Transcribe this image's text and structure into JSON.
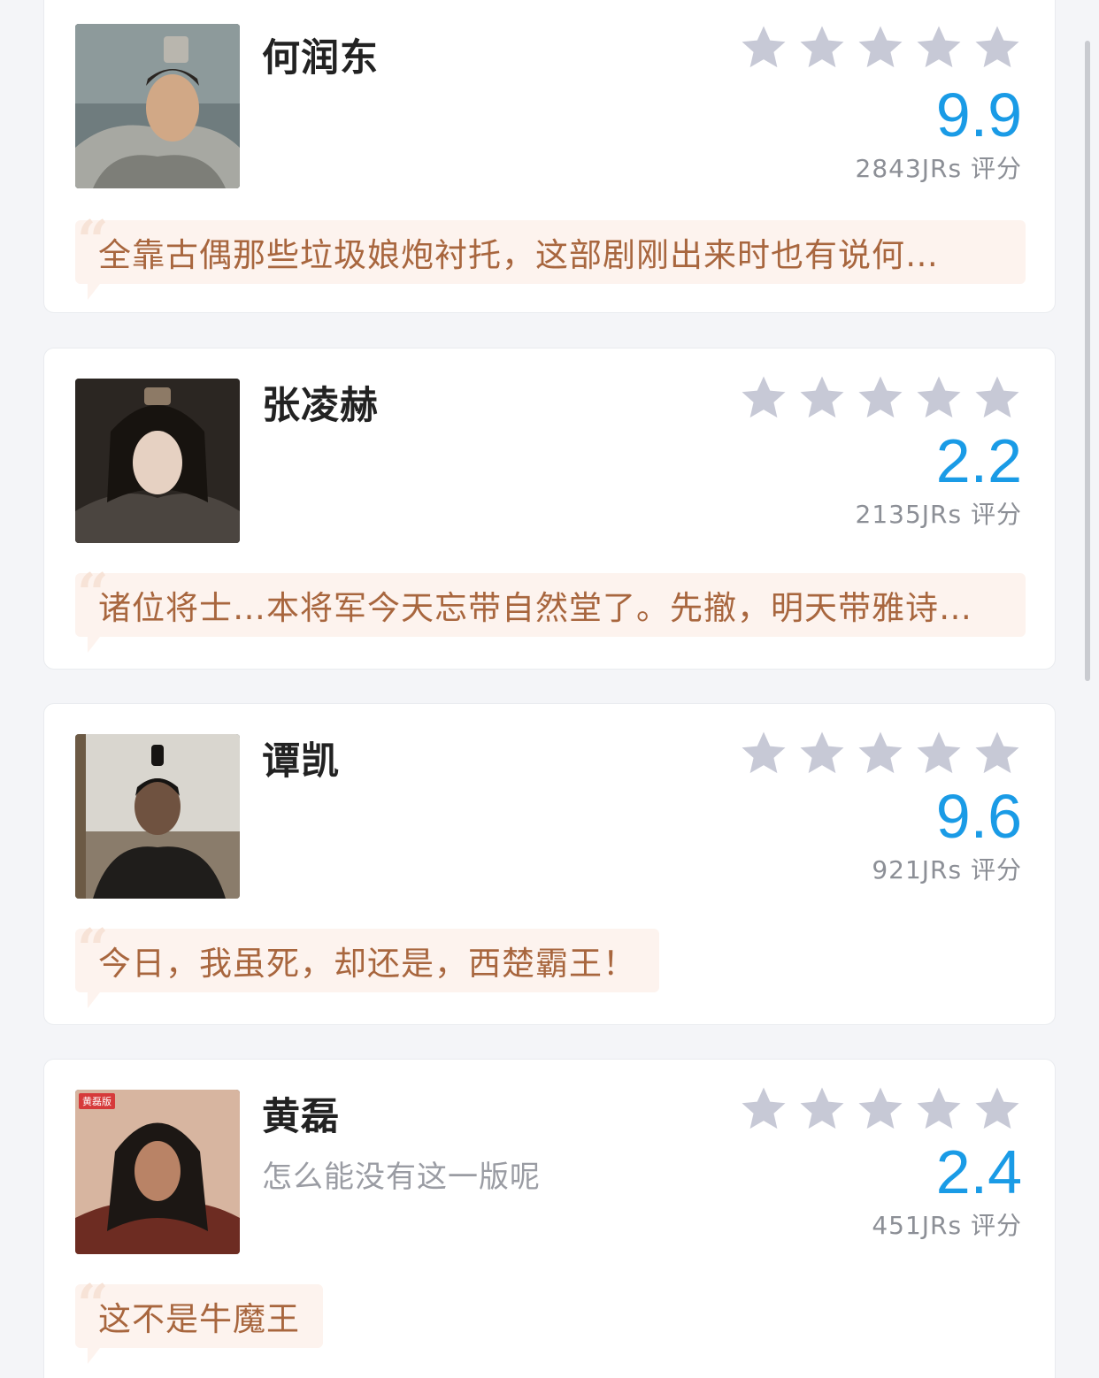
{
  "colors": {
    "score": "#1a9be6",
    "star": "#c7c9d6",
    "comment_bg": "#fdf3ee",
    "comment_text": "#a8663e"
  },
  "cards": [
    {
      "name": "何润东",
      "subtitle": "",
      "score": "9.9",
      "count": "2843JRs 评分",
      "comment": "全靠古偶那些垃圾娘炮衬托，这部剧刚出来时也有说何…",
      "avatar_icon": "portrait-armored-warrior"
    },
    {
      "name": "张凌赫",
      "subtitle": "",
      "score": "2.2",
      "count": "2135JRs 评分",
      "comment": "诸位将士…本将军今天忘带自然堂了。先撤，明天带雅诗…",
      "avatar_icon": "portrait-young-warrior"
    },
    {
      "name": "谭凯",
      "subtitle": "",
      "score": "9.6",
      "count": "921JRs 评分",
      "comment": "今日，我虽死，却还是，西楚霸王！",
      "avatar_icon": "portrait-general"
    },
    {
      "name": "黄磊",
      "subtitle": "怎么能没有这一版呢",
      "score": "2.4",
      "count": "451JRs 评分",
      "comment": "这不是牛魔王",
      "avatar_icon": "portrait-long-hair",
      "badge": "黄磊版"
    }
  ]
}
